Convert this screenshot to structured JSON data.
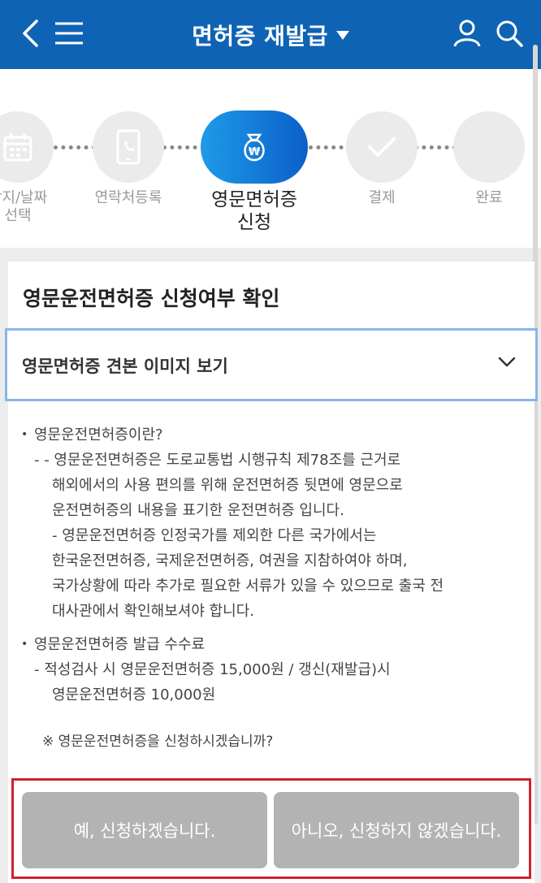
{
  "header": {
    "title": "면허증 재발급",
    "bg_color": "#0f63b4"
  },
  "steps": [
    {
      "label_line1": "장지/날짜",
      "label_line2": "선택",
      "icon": "calendar-icon"
    },
    {
      "label_line1": "연락처등록",
      "label_line2": "",
      "icon": "phone-icon"
    },
    {
      "label_line1": "영문면허증",
      "label_line2": "신청",
      "icon": "won-bag-icon",
      "active": true
    },
    {
      "label_line1": "결제",
      "label_line2": "",
      "icon": "check-icon"
    },
    {
      "label_line1": "완료",
      "label_line2": "",
      "icon": ""
    }
  ],
  "section": {
    "title": "영문운전면허증 신청여부 확인",
    "dropdown_label": "영문면허증 견본 이미지 보기"
  },
  "info": {
    "b1_title": "영문운전면허증이란?",
    "b1_l1": "- - 영문운전면허증은 도로교통법 시행규칙 제78조를 근거로",
    "b1_l2": "해외에서의 사용 편의를 위해 운전면허증 뒷면에 영문으로",
    "b1_l3": "운전면허증의 내용을 표기한 운전면허증 입니다.",
    "b1_l4": "- 영문운전면허증 인정국가를 제외한 다른 국가에서는",
    "b1_l5": "한국운전면허증, 국제운전면허증, 여권을 지참하여야 하며,",
    "b1_l6": "국가상황에 따라 추가로 필요한 서류가 있을 수 있으므로 출국 전",
    "b1_l7": "대사관에서 확인해보셔야 합니다.",
    "b2_title": "영문운전면허증 발급 수수료",
    "b2_l1": "- 적성검사 시 영문운전면허증 15,000원 / 갱신(재발급)시",
    "b2_l2": "영문운전면허증 10,000원",
    "question": "※ 영문운전면허증을 신청하시겠습니까?"
  },
  "buttons": {
    "yes": "예, 신청하겠습니다.",
    "no": "아니오, 신청하지 않겠습니다."
  }
}
